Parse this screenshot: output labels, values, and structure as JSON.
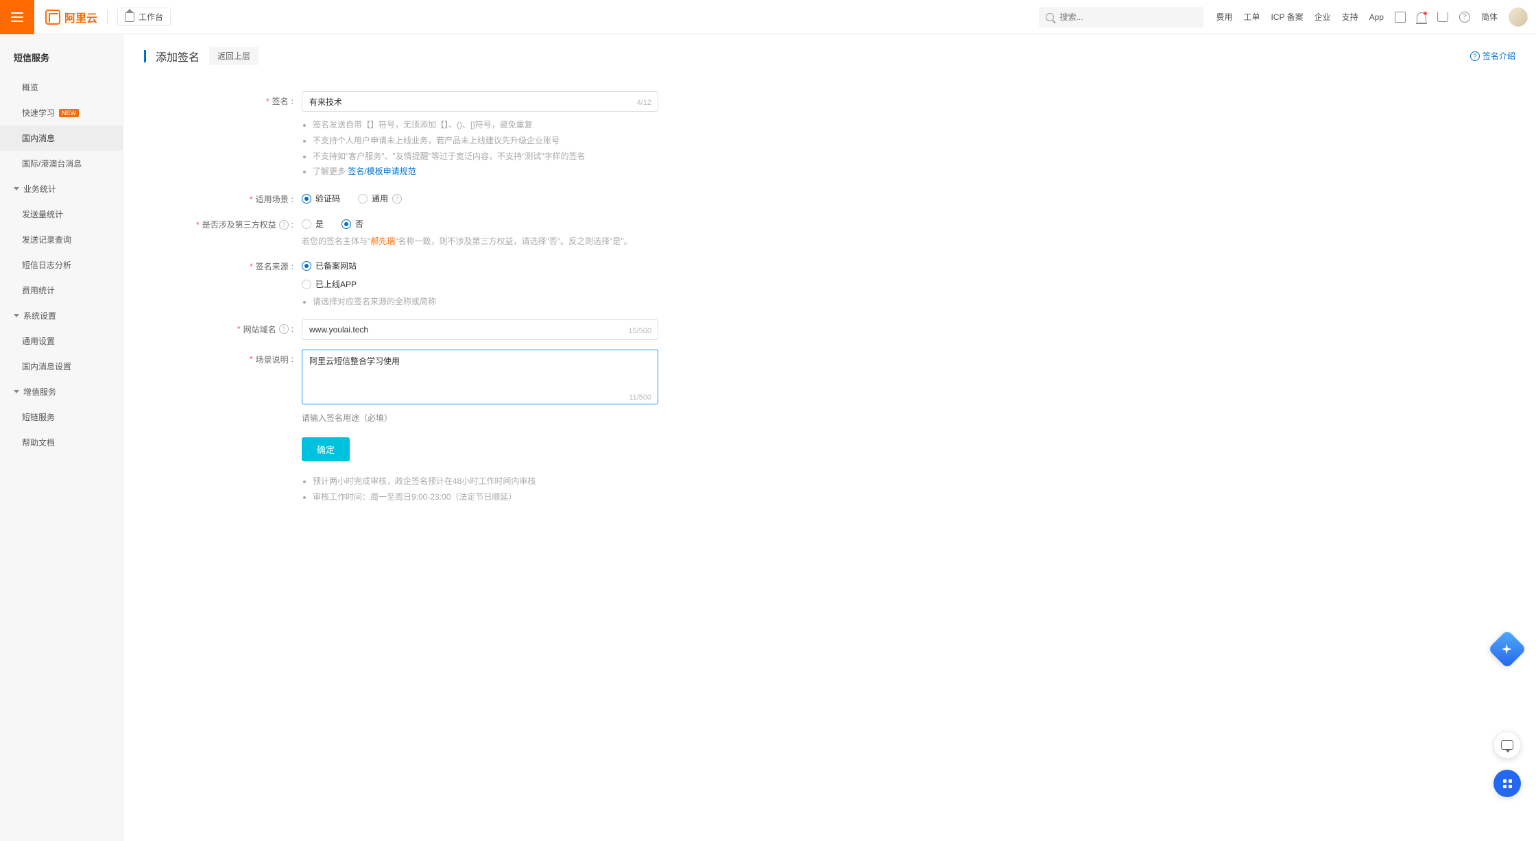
{
  "header": {
    "logo_text": "阿里云",
    "workbench": "工作台",
    "search_placeholder": "搜索...",
    "links": [
      "费用",
      "工单",
      "ICP 备案",
      "企业",
      "支持",
      "App"
    ],
    "lang": "简体"
  },
  "sidebar": {
    "service_title": "短信服务",
    "items_top": [
      {
        "label": "概览"
      },
      {
        "label": "快速学习",
        "badge": "NEW"
      },
      {
        "label": "国内消息",
        "active": true
      },
      {
        "label": "国际/港澳台消息"
      }
    ],
    "groups": [
      {
        "label": "业务统计",
        "items": [
          "发送量统计",
          "发送记录查询",
          "短信日志分析",
          "费用统计"
        ]
      },
      {
        "label": "系统设置",
        "items": [
          "通用设置",
          "国内消息设置"
        ]
      },
      {
        "label": "增值服务",
        "items": [
          "短链服务",
          "帮助文档"
        ]
      }
    ]
  },
  "page": {
    "title": "添加签名",
    "back": "返回上层",
    "help": "签名介绍"
  },
  "form": {
    "signature": {
      "label": "签名",
      "value": "有来技术",
      "counter": "4/12",
      "hints": [
        "签名发送自带【】符号，无须添加【】、()、[]符号，避免重复",
        "不支持个人用户申请未上线业务，若产品未上线建议先升级企业账号",
        "不支持如\"客户服务\"、\"友情提醒\"等过于宽泛内容，不支持\"测试\"字样的签名"
      ],
      "more_prefix": "了解更多 ",
      "more_link": "签名/模板申请规范"
    },
    "scene": {
      "label": "适用场景",
      "options": [
        "验证码",
        "通用"
      ],
      "checked": 0
    },
    "thirdparty": {
      "label": "是否涉及第三方权益",
      "options": [
        "是",
        "否"
      ],
      "checked": 1,
      "hint_pre": "若您的签名主体与\"",
      "hint_mid": "郝先瑞",
      "hint_post": "\"名称一致，则不涉及第三方权益，请选择\"否\"。反之则选择\"是\"。"
    },
    "source": {
      "label": "签名来源",
      "options": [
        "已备案网站",
        "已上线APP"
      ],
      "checked": 0,
      "hint": "请选择对应签名来源的全称或简称"
    },
    "domain": {
      "label": "网站域名",
      "value": "www.youlai.tech",
      "counter": "15/500"
    },
    "desc": {
      "label": "场景说明",
      "value": "阿里云短信整合学习使用",
      "counter": "11/500",
      "hint": "请输入签名用途（必填）"
    },
    "submit": "确定",
    "footer_hints": [
      "预计两小时完成审核，政企签名预计在48小时工作时间内审核",
      "审核工作时间：周一至周日9:00-23:00（法定节日顺延）"
    ]
  }
}
